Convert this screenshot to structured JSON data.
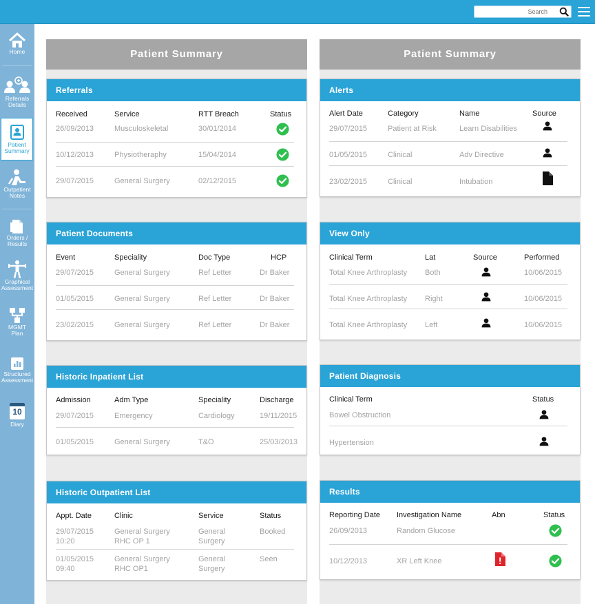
{
  "search": {
    "placeholder": "Search"
  },
  "nav": [
    {
      "label": "Home",
      "icon": "home-icon"
    },
    {
      "label": "Referrals Details",
      "icon": "referrals-icon"
    },
    {
      "label": "Patient Summary",
      "icon": "patient-summary-icon",
      "active": true
    },
    {
      "label": "Outpatient Notes",
      "icon": "outpatient-notes-icon"
    },
    {
      "label": "Orders / Results",
      "icon": "orders-results-icon"
    },
    {
      "label": "Graphical Assessment",
      "icon": "graphical-assessment-icon"
    },
    {
      "label": "MGMT Plan",
      "icon": "mgmt-plan-icon"
    },
    {
      "label": "Structured Assessment",
      "icon": "structured-assessment-icon"
    },
    {
      "label": "Diary",
      "icon": "diary-icon",
      "day": "10"
    }
  ],
  "left": {
    "title": "Patient Summary",
    "referrals": {
      "title": "Referrals",
      "headers": [
        "Received",
        "Service",
        "RTT Breach",
        "Status"
      ],
      "rows": [
        [
          "26/09/2013",
          "Musculoskeletal",
          "30/01/2014"
        ],
        [
          "10/12/2013",
          "Physiotheraphy",
          "15/04/2014"
        ],
        [
          "29/07/2015",
          "General Surgery",
          "02/12/2015"
        ]
      ],
      "status_icon": "check-circle-icon"
    },
    "documents": {
      "title": "Patient Documents",
      "headers": [
        "Event",
        "Speciality",
        "Doc Type",
        "HCP"
      ],
      "rows": [
        [
          "29/07/2015",
          "General Surgery",
          "Ref Letter",
          "Dr Baker"
        ],
        [
          "01/05/2015",
          "General Surgery",
          "Ref Letter",
          "Dr Baker"
        ],
        [
          "23/02/2015",
          "General Surgery",
          "Ref Letter",
          "Dr Baker"
        ]
      ]
    },
    "inpatient": {
      "title": "Historic Inpatient List",
      "headers": [
        "Admission",
        "Adm Type",
        "Speciality",
        "Discharge"
      ],
      "rows": [
        [
          "29/07/2015",
          "Emergency",
          "Cardiology",
          "19/11/2015"
        ],
        [
          "01/05/2015",
          "General Surgery",
          "T&O",
          "25/03/2013"
        ]
      ]
    },
    "outpatient": {
      "title": "Historic Outpatient List",
      "headers": [
        "Appt. Date",
        "Clinic",
        "Service",
        "Status"
      ],
      "rows": [
        {
          "date": "29/07/2015",
          "time": "10:20",
          "clinic": "General Surgery",
          "clinic2": "RHC OP 1",
          "service": "General",
          "service2": "Surgery",
          "status": "Booked"
        },
        {
          "date": "01/05/2015",
          "time": "09:40",
          "clinic": "General Surgery",
          "clinic2": "RHC OP1",
          "service": "General",
          "service2": "Surgery",
          "status": "Seen"
        }
      ]
    }
  },
  "right": {
    "title": "Patient Summary",
    "alerts": {
      "title": "Alerts",
      "headers": [
        "Alert Date",
        "Category",
        "Name",
        "Source"
      ],
      "rows": [
        [
          "29/07/2015",
          "Patient at Risk",
          "Learn Disabilities",
          "person-icon"
        ],
        [
          "01/05/2015",
          "Clinical",
          "Adv Directive",
          "person-icon"
        ],
        [
          "23/02/2015",
          "Clinical",
          "Intubation",
          "document-icon"
        ]
      ]
    },
    "viewonly": {
      "title": "View Only",
      "headers": [
        "Clinical Term",
        "Lat",
        "Source",
        "Performed"
      ],
      "rows": [
        [
          "Total Knee Arthroplasty",
          "Both",
          "10/06/2015"
        ],
        [
          "Total Knee Arthroplasty",
          "Right",
          "10/06/2015"
        ],
        [
          "Total Knee Arthroplasty",
          "Left",
          "10/06/2015"
        ]
      ],
      "source_icon": "person-icon"
    },
    "diagnosis": {
      "title": "Patient Diagnosis",
      "headers": [
        "Clinical Term",
        "Status"
      ],
      "rows": [
        "Bowel Obstruction",
        "Hypertension"
      ],
      "status_icon": "person-icon"
    },
    "results": {
      "title": "Results",
      "headers": [
        "Reporting Date",
        "Investigation Name",
        "Abn",
        "Status"
      ],
      "rows": [
        {
          "date": "26/09/2013",
          "name": "Random Glucose",
          "abn": false
        },
        {
          "date": "10/12/2013",
          "name": "XR Left Knee",
          "abn": true
        }
      ],
      "abn_icon": "abnormal-document-icon",
      "status_icon": "check-circle-icon"
    }
  },
  "colors": {
    "accent": "#2aa3d6",
    "sidebar": "#7fb3d8",
    "check": "#2fbf4f",
    "abnormal": "#e0242b",
    "column_bg": "#ebebeb",
    "column_header": "#a6a6a6"
  }
}
